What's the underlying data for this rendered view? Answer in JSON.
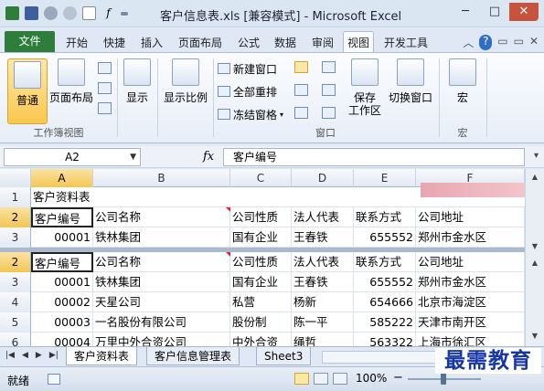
{
  "window": {
    "title": "客户信息表.xls [兼容模式] - Microsoft Excel",
    "buttons": [
      "─",
      "□",
      "✕"
    ]
  },
  "qat": {
    "icons": [
      "excel-icon",
      "save-icon",
      "undo-icon",
      "redo-icon",
      "new-icon",
      "function-icon",
      "customize-icon"
    ],
    "fx": "f"
  },
  "ribbon_tabs": [
    "文件",
    "开始",
    "快捷",
    "插入",
    "页面布局",
    "公式",
    "数据",
    "审阅",
    "视图",
    "开发工具"
  ],
  "active_tab": "视图",
  "tab_icons": [
    "︿",
    "?",
    "▭",
    "▭",
    "✕"
  ],
  "groups": {
    "workbook_views": {
      "label": "工作簿视图",
      "normal": "普通",
      "page_layout": "页面布局"
    },
    "show": {
      "label": "显示"
    },
    "zoom": {
      "label": "显示比例"
    },
    "window": {
      "label": "窗口",
      "new_window": "新建窗口",
      "arrange_all": "全部重排",
      "freeze_panes": "冻结窗格",
      "save_workspace": "保存\n工作区",
      "switch_windows": "切换窗口"
    },
    "macros": {
      "label": "宏",
      "macro": "宏"
    }
  },
  "formula_bar": {
    "name_box": "A2",
    "fx": "fx",
    "value": "客户编号"
  },
  "columns": [
    "A",
    "B",
    "C",
    "D",
    "E",
    "F"
  ],
  "selected_column": "A",
  "rows_top": [
    {
      "num": "1",
      "cells": [
        "客户资料表",
        "",
        "",
        "",
        "",
        ""
      ]
    },
    {
      "num": "2",
      "cells": [
        "客户编号",
        "公司名称",
        "公司性质",
        "法人代表",
        "联系方式",
        "公司地址"
      ]
    },
    {
      "num": "3",
      "cells": [
        "00001",
        "铁林集团",
        "国有企业",
        "王春铁",
        "655552",
        "郑州市金水区"
      ]
    }
  ],
  "rows_bottom": [
    {
      "num": "2",
      "cells": [
        "客户编号",
        "公司名称",
        "公司性质",
        "法人代表",
        "联系方式",
        "公司地址"
      ]
    },
    {
      "num": "3",
      "cells": [
        "00001",
        "铁林集团",
        "国有企业",
        "王春铁",
        "655552",
        "郑州市金水区"
      ]
    },
    {
      "num": "4",
      "cells": [
        "00002",
        "天星公司",
        "私营",
        "杨新",
        "654666",
        "北京市海淀区"
      ]
    },
    {
      "num": "5",
      "cells": [
        "00003",
        "一名股份有限公司",
        "股份制",
        "陈一平",
        "585222",
        "天津市南开区"
      ]
    },
    {
      "num": "6",
      "cells": [
        "00004",
        "万里中外合资公司",
        "中外合资",
        "绳哲",
        "563322",
        "上海市徐汇区"
      ]
    }
  ],
  "sheet_tabs": [
    "客户资料表",
    "客户信息管理表",
    "Sheet3"
  ],
  "active_sheet": "客户资料表",
  "status": {
    "text": "就绪",
    "zoom": "100%",
    "minus": "−"
  },
  "watermark": "最需教育"
}
